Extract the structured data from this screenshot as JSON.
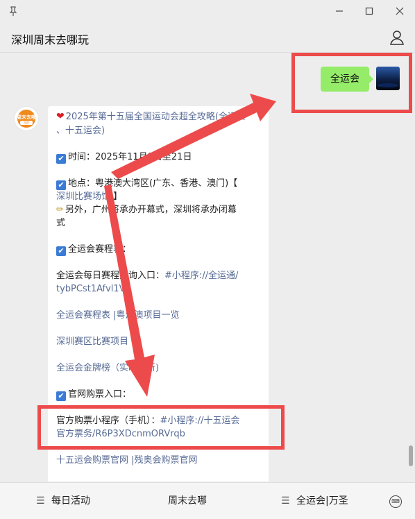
{
  "window": {
    "pin": "📌",
    "min": "—",
    "max": "☐",
    "close": "✕"
  },
  "header": {
    "title": "深圳周末去哪玩"
  },
  "me": {
    "message": "全运会"
  },
  "oa": {
    "avatar_text": "周末去哪",
    "avatar_sub": "深圳"
  },
  "article": {
    "line1a": "2025年第十五届全国运动会超全攻略(全运会",
    "line1b": "、十五运会)",
    "time": "时间：2025年11月9日至21日",
    "place_a": "地点：粤港澳大湾区(广东、香港、澳门)【",
    "place_b_link": "深圳比赛场馆",
    "place_b_tail": " 】",
    "note_a": "另外，广州将承办开幕式，深圳将承办闭幕",
    "note_b": "式",
    "schedule_title": "全运会赛程表：",
    "query_a": "全运会每日赛程查询入口：",
    "query_a_link": "#小程序://全运通/",
    "query_b_link": "tybPCst1Afvl1Vy",
    "schedule_link": "全运会赛程表 |粤港澳项目一览",
    "sz_link": "深圳赛区比赛项目",
    "medal_link": "全运会金牌榜（实时更新)",
    "ticket_title": "官网购票入口：",
    "mini_a": "官方购票小程序（手机）：",
    "mini_a_link": "#小程序://十五运会",
    "mini_b_link": "官方票务/R6P3XDcnmORVrqb",
    "official_link": "十五运会购票官网 |残奥会购票官网"
  },
  "bottom": {
    "menu1": "每日活动",
    "menu2": "周末去哪",
    "menu3": "全运会|万圣",
    "ham": "☰"
  },
  "colors": {
    "accent_red": "#ed4b4b",
    "bubble_green": "#95ec69",
    "link": "#576b95"
  }
}
